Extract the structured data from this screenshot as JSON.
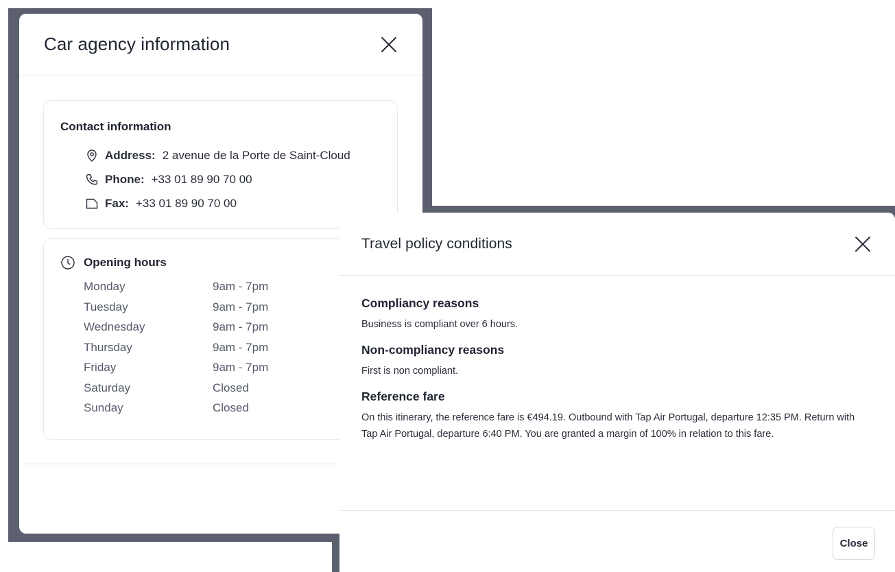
{
  "agency": {
    "title": "Car agency information",
    "contact": {
      "heading": "Contact information",
      "address_label": "Address:",
      "address_value": "2 avenue de la Porte de Saint-Cloud",
      "phone_label": "Phone:",
      "phone_value": "+33 01 89 90 70 00",
      "fax_label": "Fax:",
      "fax_value": "+33 01 89 90 70 00"
    },
    "hours": {
      "heading": "Opening hours",
      "rows": [
        {
          "day": "Monday",
          "time": "9am - 7pm"
        },
        {
          "day": "Tuesday",
          "time": "9am - 7pm"
        },
        {
          "day": "Wednesday",
          "time": "9am - 7pm"
        },
        {
          "day": "Thursday",
          "time": "9am - 7pm"
        },
        {
          "day": "Friday",
          "time": "9am - 7pm"
        },
        {
          "day": "Saturday",
          "time": "Closed"
        },
        {
          "day": "Sunday",
          "time": "Closed"
        }
      ]
    }
  },
  "policy": {
    "title": "Travel policy conditions",
    "sections": [
      {
        "heading": "Compliancy reasons",
        "text": "Business is compliant over 6 hours."
      },
      {
        "heading": "Non-compliancy reasons",
        "text": "First is non compliant."
      },
      {
        "heading": "Reference fare",
        "text": "On this itinerary, the reference fare is €494.19. Outbound with Tap Air Portugal, departure 12:35 PM. Return with Tap Air Portugal, departure 6:40 PM. You are granted a margin of 100% in relation to this fare."
      }
    ],
    "close_label": "Close"
  },
  "colors": {
    "backdrop": "#5b5f6e",
    "text": "#1f2430",
    "border": "#e6e8ee"
  }
}
